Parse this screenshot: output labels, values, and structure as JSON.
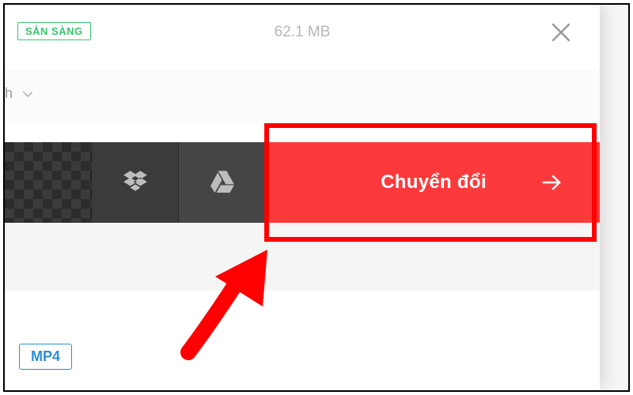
{
  "topbar": {
    "status_label": "SẴN SÀNG",
    "file_size": "62.1 MB"
  },
  "dropdown": {
    "partial_text": "h"
  },
  "actions": {
    "convert_label": "Chuyển đổi"
  },
  "format": {
    "badge": "MP4"
  },
  "icons": {
    "close": "close",
    "dropbox": "dropbox",
    "gdrive": "google-drive",
    "arrow_right": "arrow-right",
    "chevron_down": "chevron-down"
  },
  "colors": {
    "accent_red": "#fc3a3c",
    "status_green": "#36c66c",
    "format_blue": "#2c8fd6",
    "annotation_red": "#ff0000"
  }
}
